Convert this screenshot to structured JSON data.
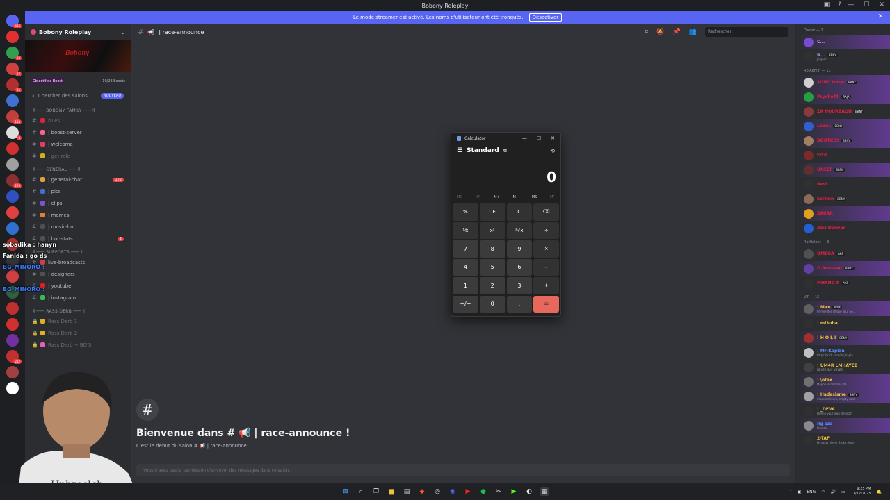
{
  "window": {
    "title": "Bobony Roleplay",
    "controls": {
      "min": "—",
      "max": "☐",
      "close": "✕"
    }
  },
  "banner": {
    "text": "Le mode streamer est activé. Les noms d'utilisateur ont été tronqués.",
    "button": "Désactiver",
    "close": "✕"
  },
  "servers": [
    {
      "color": "#5865f2",
      "badge": "466"
    },
    {
      "color": "#e03030",
      "badge": ""
    },
    {
      "color": "#30a050",
      "badge": "13"
    },
    {
      "color": "#d04040",
      "badge": "27"
    },
    {
      "color": "#b03030",
      "badge": "35"
    },
    {
      "color": "#4070d0",
      "badge": ""
    },
    {
      "color": "#c04040",
      "badge": "144"
    },
    {
      "color": "#dddddd",
      "badge": "8"
    },
    {
      "color": "#d03030",
      "badge": ""
    },
    {
      "color": "#a0a0a0",
      "badge": ""
    },
    {
      "color": "#8a3030",
      "badge": "276"
    },
    {
      "color": "#3050c0",
      "badge": ""
    },
    {
      "color": "#e04040",
      "badge": ""
    },
    {
      "color": "#3070d0",
      "badge": ""
    },
    {
      "color": "#b03030",
      "badge": ""
    },
    {
      "color": "#333333",
      "badge": ""
    },
    {
      "color": "#d04040",
      "badge": ""
    },
    {
      "color": "#306040",
      "badge": ""
    },
    {
      "color": "#c03030",
      "badge": ""
    },
    {
      "color": "#d03030",
      "badge": ""
    },
    {
      "color": "#7030a0",
      "badge": ""
    },
    {
      "color": "#c03030",
      "badge": "282"
    },
    {
      "color": "#a04040",
      "badge": ""
    },
    {
      "color": "#ffffff",
      "badge": ""
    }
  ],
  "sidebar": {
    "guild_name": "Bobony Roleplay",
    "boost_goal": "Objectif de Boost",
    "boost_count": "10/28 Boosts",
    "search": "Chercher des salons",
    "new_badge": "NOUVEAU",
    "categories": [
      {
        "name": "〢─── BOBONY FAMILY ───〢",
        "channels": [
          {
            "name": "rules",
            "emoji": "#e02040",
            "muted": true,
            "count": ""
          },
          {
            "name": "| boost-server",
            "emoji": "#ff6090",
            "muted": false,
            "count": ""
          },
          {
            "name": "| welcome",
            "emoji": "#e04060",
            "muted": false,
            "count": ""
          },
          {
            "name": "| get-role",
            "emoji": "#d0b020",
            "muted": true,
            "count": ""
          }
        ]
      },
      {
        "name": "〢─── GENERAL ───〢",
        "channels": [
          {
            "name": "| general-chat",
            "emoji": "#e0a040",
            "muted": false,
            "count": "122"
          },
          {
            "name": "| pics",
            "emoji": "#4070d0",
            "muted": false,
            "count": ""
          },
          {
            "name": "| clips",
            "emoji": "#8050d0",
            "muted": false,
            "count": ""
          },
          {
            "name": "| memes",
            "emoji": "#e08030",
            "muted": false,
            "count": ""
          },
          {
            "name": "| music-bot",
            "emoji": "#505050",
            "muted": false,
            "count": ""
          },
          {
            "name": "| bot-stats",
            "emoji": "#505050",
            "muted": false,
            "count": "2"
          }
        ]
      },
      {
        "name": "〢─── SUPPORTS ───〢",
        "channels": [
          {
            "name": "live-broadcasts",
            "emoji": "#d04040",
            "muted": false,
            "count": ""
          },
          {
            "name": "| designers",
            "emoji": "#505050",
            "muted": false,
            "count": ""
          },
          {
            "name": "| youtube",
            "emoji": "#e02020",
            "muted": false,
            "count": ""
          },
          {
            "name": "| instagram",
            "emoji": "#30c050",
            "muted": false,
            "count": ""
          }
        ]
      },
      {
        "name": "〢─── RASS DERB ───〢",
        "channels": [
          {
            "name": "Rass Derb 1",
            "emoji": "#e0b020",
            "muted": true,
            "count": "",
            "voice": true
          },
          {
            "name": "Rass Derb 2",
            "emoji": "#e0b020",
            "muted": true,
            "count": "",
            "voice": true
          },
          {
            "name": "Rass Derb + BG'S",
            "emoji": "#e060c0",
            "muted": true,
            "count": "",
            "voice": true
          }
        ]
      }
    ]
  },
  "overlay": [
    {
      "text": "sobadika : hanyn",
      "color": "#ffffff"
    },
    {
      "text": "Fanida : go ds",
      "color": "#ffffff"
    },
    {
      "text": "BG_MINORO :",
      "color": "#3a7bff"
    },
    {
      "text": "BG_MINORO :",
      "color": "#3a7bff"
    }
  ],
  "chat": {
    "channel": "| race-announce",
    "search_placeholder": "Rechercher",
    "welcome_title": "Bienvenue dans # 📢 | race-announce !",
    "welcome_sub": "C'est le début du salon # 📢 | race-announce.",
    "no_permission": "Vous n'avez pas la permission d'envoyer des messages dans ce salon.",
    "hash": "#"
  },
  "members": {
    "groups": [
      {
        "role": "Owner — 2",
        "items": [
          {
            "name": "C...",
            "sub": "",
            "tag": "",
            "color": "#b090ff",
            "avatar": "#7a4ad0",
            "hl": true
          },
          {
            "name": "N...",
            "sub": "JenJoon",
            "tag": "BBNY",
            "color": "#b090ff",
            "avatar": "#303030",
            "hl": false
          }
        ]
      },
      {
        "role": "Rp Admin — 11",
        "items": [
          {
            "name": "$ONO Omar",
            "sub": "",
            "tag": "BBNY",
            "color": "#e02040",
            "avatar": "#d0d0d0",
            "hl": true
          },
          {
            "name": "PsychoAli",
            "sub": "",
            "tag": "RAJA",
            "color": "#e02040",
            "avatar": "#20a040",
            "hl": true
          },
          {
            "name": "ZA HOURBAQH",
            "sub": "",
            "tag": "BBNY",
            "color": "#e02040",
            "avatar": "#8a3a3a",
            "hl": false
          },
          {
            "name": "Leon1",
            "sub": "",
            "tag": "BBNY",
            "color": "#e02040",
            "avatar": "#3060d0",
            "hl": true
          },
          {
            "name": "BOOTKEY",
            "sub": "",
            "tag": "BBNY",
            "color": "#e02040",
            "avatar": "#a08060",
            "hl": true
          },
          {
            "name": "Ertil",
            "sub": "",
            "tag": "",
            "color": "#e02040",
            "avatar": "#7a2a2a",
            "hl": false
          },
          {
            "name": "UNEEF",
            "sub": "",
            "tag": "BBNY",
            "color": "#e02040",
            "avatar": "#603030",
            "hl": true
          },
          {
            "name": "Rest",
            "sub": "",
            "tag": "",
            "color": "#e02040",
            "avatar": "#303030",
            "hl": false
          },
          {
            "name": "Scrtmh",
            "sub": "",
            "tag": "BBNY",
            "color": "#e02040",
            "avatar": "#8a6a5a",
            "hl": false
          },
          {
            "name": "ZAKAR",
            "sub": "",
            "tag": "",
            "color": "#e02040",
            "avatar": "#e0a020",
            "hl": true
          },
          {
            "name": "Aziz Derwan",
            "sub": "",
            "tag": "",
            "color": "#e02040",
            "avatar": "#2060d0",
            "hl": false
          }
        ]
      },
      {
        "role": "Rp Helper — 3",
        "items": [
          {
            "name": "OMEGA",
            "sub": "",
            "tag": "AKS",
            "color": "#e02040",
            "avatar": "#505050",
            "hl": false
          },
          {
            "name": "D.Roussan",
            "sub": "",
            "tag": "BBNY",
            "color": "#e02040",
            "avatar": "#6040a0",
            "hl": true
          },
          {
            "name": "MHAND K",
            "sub": "",
            "tag": "AKS",
            "color": "#e02040",
            "avatar": "#303030",
            "hl": false
          }
        ]
      },
      {
        "role": "VIP — 15",
        "items": [
          {
            "name": "! Max",
            "sub": "PrimeFilter I Make Your Se...",
            "tag": "PRIM",
            "color": "#f2c040",
            "avatar": "#606060",
            "hl": true
          },
          {
            "name": "! ml3oba",
            "sub": "",
            "tag": "",
            "color": "#f2c040",
            "avatar": "#303030",
            "hl": false
          },
          {
            "name": "! H O L I",
            "sub": "",
            "tag": "BBNY",
            "color": "#f2c040",
            "avatar": "#a03030",
            "hl": true
          },
          {
            "name": "! Mr-Kaplan",
            "sub": "https://kick.com/mr_kapla...",
            "tag": "",
            "color": "#5a8aff",
            "avatar": "#c0c0c0",
            "hl": false
          },
          {
            "name": "! UM4R LMHAYEB",
            "sub": "NEVER SAY NEVER",
            "tag": "",
            "color": "#f2c040",
            "avatar": "#404040",
            "hl": false
          },
          {
            "name": "! \\oféx",
            "sub": "Maybe in another life",
            "tag": "",
            "color": "#f2c040",
            "avatar": "#707070",
            "hl": true
          },
          {
            "name": "! Hadesisme",
            "sub": "Crowded room, empty soul",
            "tag": "BBNY",
            "color": "#f2c040",
            "avatar": "#a0a0a0",
            "hl": true
          },
          {
            "name": "! _DEVA",
            "sub": "Define your own strength",
            "tag": "",
            "color": "#f2c040",
            "avatar": "#303030",
            "hl": false
          },
          {
            "name": "Ilg aza",
            "sub": "Illusion",
            "tag": "",
            "color": "#5a8aff",
            "avatar": "#8a8a8a",
            "hl": true
          },
          {
            "name": "2-TAF",
            "sub": "Dynasty Never Broke Again",
            "tag": "",
            "color": "#f2c040",
            "avatar": "#303030",
            "hl": false
          }
        ]
      }
    ]
  },
  "calculator": {
    "title": "Calculator",
    "mode": "Standard",
    "display": "0",
    "memory": [
      {
        "label": "MC",
        "dim": true
      },
      {
        "label": "MR",
        "dim": true
      },
      {
        "label": "M+",
        "dim": false
      },
      {
        "label": "M−",
        "dim": false
      },
      {
        "label": "MS",
        "dim": false
      },
      {
        "label": "M˅",
        "dim": true
      }
    ],
    "keys": [
      {
        "label": "%",
        "kind": "fn",
        "name": "percent"
      },
      {
        "label": "CE",
        "kind": "fn",
        "name": "clear-entry"
      },
      {
        "label": "C",
        "kind": "fn",
        "name": "clear"
      },
      {
        "label": "⌫",
        "kind": "fn",
        "name": "backspace"
      },
      {
        "label": "⅟x",
        "kind": "fn",
        "name": "reciprocal"
      },
      {
        "label": "x²",
        "kind": "fn",
        "name": "square"
      },
      {
        "label": "²√x",
        "kind": "fn",
        "name": "square-root"
      },
      {
        "label": "÷",
        "kind": "fn",
        "name": "divide"
      },
      {
        "label": "7",
        "kind": "num",
        "name": "7"
      },
      {
        "label": "8",
        "kind": "num",
        "name": "8"
      },
      {
        "label": "9",
        "kind": "num",
        "name": "9"
      },
      {
        "label": "×",
        "kind": "fn",
        "name": "multiply"
      },
      {
        "label": "4",
        "kind": "num",
        "name": "4"
      },
      {
        "label": "5",
        "kind": "num",
        "name": "5"
      },
      {
        "label": "6",
        "kind": "num",
        "name": "6"
      },
      {
        "label": "−",
        "kind": "fn",
        "name": "subtract"
      },
      {
        "label": "1",
        "kind": "num",
        "name": "1"
      },
      {
        "label": "2",
        "kind": "num",
        "name": "2"
      },
      {
        "label": "3",
        "kind": "num",
        "name": "3"
      },
      {
        "label": "+",
        "kind": "fn",
        "name": "add"
      },
      {
        "label": "+/−",
        "kind": "num",
        "name": "negate"
      },
      {
        "label": "0",
        "kind": "num",
        "name": "0"
      },
      {
        "label": ".",
        "kind": "num",
        "name": "decimal"
      },
      {
        "label": "=",
        "kind": "eq",
        "name": "equals"
      }
    ]
  },
  "taskbar": {
    "lang": "ENG",
    "time": "9:25 PM",
    "date": "11/12/2025"
  }
}
